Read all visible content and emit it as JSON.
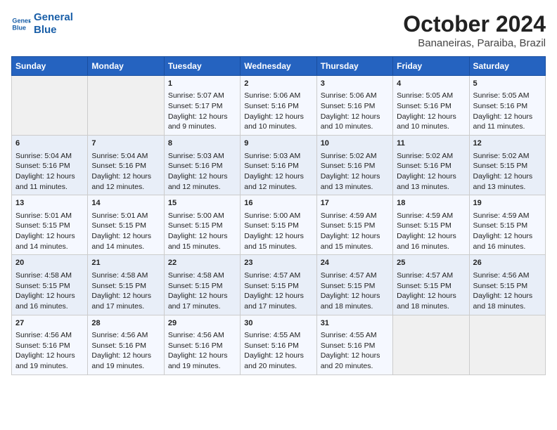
{
  "header": {
    "logo_line1": "General",
    "logo_line2": "Blue",
    "month": "October 2024",
    "location": "Bananeiras, Paraiba, Brazil"
  },
  "days_of_week": [
    "Sunday",
    "Monday",
    "Tuesday",
    "Wednesday",
    "Thursday",
    "Friday",
    "Saturday"
  ],
  "weeks": [
    [
      {
        "day": "",
        "info": ""
      },
      {
        "day": "",
        "info": ""
      },
      {
        "day": "1",
        "info": "Sunrise: 5:07 AM\nSunset: 5:17 PM\nDaylight: 12 hours\nand 9 minutes."
      },
      {
        "day": "2",
        "info": "Sunrise: 5:06 AM\nSunset: 5:16 PM\nDaylight: 12 hours\nand 10 minutes."
      },
      {
        "day": "3",
        "info": "Sunrise: 5:06 AM\nSunset: 5:16 PM\nDaylight: 12 hours\nand 10 minutes."
      },
      {
        "day": "4",
        "info": "Sunrise: 5:05 AM\nSunset: 5:16 PM\nDaylight: 12 hours\nand 10 minutes."
      },
      {
        "day": "5",
        "info": "Sunrise: 5:05 AM\nSunset: 5:16 PM\nDaylight: 12 hours\nand 11 minutes."
      }
    ],
    [
      {
        "day": "6",
        "info": "Sunrise: 5:04 AM\nSunset: 5:16 PM\nDaylight: 12 hours\nand 11 minutes."
      },
      {
        "day": "7",
        "info": "Sunrise: 5:04 AM\nSunset: 5:16 PM\nDaylight: 12 hours\nand 12 minutes."
      },
      {
        "day": "8",
        "info": "Sunrise: 5:03 AM\nSunset: 5:16 PM\nDaylight: 12 hours\nand 12 minutes."
      },
      {
        "day": "9",
        "info": "Sunrise: 5:03 AM\nSunset: 5:16 PM\nDaylight: 12 hours\nand 12 minutes."
      },
      {
        "day": "10",
        "info": "Sunrise: 5:02 AM\nSunset: 5:16 PM\nDaylight: 12 hours\nand 13 minutes."
      },
      {
        "day": "11",
        "info": "Sunrise: 5:02 AM\nSunset: 5:16 PM\nDaylight: 12 hours\nand 13 minutes."
      },
      {
        "day": "12",
        "info": "Sunrise: 5:02 AM\nSunset: 5:15 PM\nDaylight: 12 hours\nand 13 minutes."
      }
    ],
    [
      {
        "day": "13",
        "info": "Sunrise: 5:01 AM\nSunset: 5:15 PM\nDaylight: 12 hours\nand 14 minutes."
      },
      {
        "day": "14",
        "info": "Sunrise: 5:01 AM\nSunset: 5:15 PM\nDaylight: 12 hours\nand 14 minutes."
      },
      {
        "day": "15",
        "info": "Sunrise: 5:00 AM\nSunset: 5:15 PM\nDaylight: 12 hours\nand 15 minutes."
      },
      {
        "day": "16",
        "info": "Sunrise: 5:00 AM\nSunset: 5:15 PM\nDaylight: 12 hours\nand 15 minutes."
      },
      {
        "day": "17",
        "info": "Sunrise: 4:59 AM\nSunset: 5:15 PM\nDaylight: 12 hours\nand 15 minutes."
      },
      {
        "day": "18",
        "info": "Sunrise: 4:59 AM\nSunset: 5:15 PM\nDaylight: 12 hours\nand 16 minutes."
      },
      {
        "day": "19",
        "info": "Sunrise: 4:59 AM\nSunset: 5:15 PM\nDaylight: 12 hours\nand 16 minutes."
      }
    ],
    [
      {
        "day": "20",
        "info": "Sunrise: 4:58 AM\nSunset: 5:15 PM\nDaylight: 12 hours\nand 16 minutes."
      },
      {
        "day": "21",
        "info": "Sunrise: 4:58 AM\nSunset: 5:15 PM\nDaylight: 12 hours\nand 17 minutes."
      },
      {
        "day": "22",
        "info": "Sunrise: 4:58 AM\nSunset: 5:15 PM\nDaylight: 12 hours\nand 17 minutes."
      },
      {
        "day": "23",
        "info": "Sunrise: 4:57 AM\nSunset: 5:15 PM\nDaylight: 12 hours\nand 17 minutes."
      },
      {
        "day": "24",
        "info": "Sunrise: 4:57 AM\nSunset: 5:15 PM\nDaylight: 12 hours\nand 18 minutes."
      },
      {
        "day": "25",
        "info": "Sunrise: 4:57 AM\nSunset: 5:15 PM\nDaylight: 12 hours\nand 18 minutes."
      },
      {
        "day": "26",
        "info": "Sunrise: 4:56 AM\nSunset: 5:15 PM\nDaylight: 12 hours\nand 18 minutes."
      }
    ],
    [
      {
        "day": "27",
        "info": "Sunrise: 4:56 AM\nSunset: 5:16 PM\nDaylight: 12 hours\nand 19 minutes."
      },
      {
        "day": "28",
        "info": "Sunrise: 4:56 AM\nSunset: 5:16 PM\nDaylight: 12 hours\nand 19 minutes."
      },
      {
        "day": "29",
        "info": "Sunrise: 4:56 AM\nSunset: 5:16 PM\nDaylight: 12 hours\nand 19 minutes."
      },
      {
        "day": "30",
        "info": "Sunrise: 4:55 AM\nSunset: 5:16 PM\nDaylight: 12 hours\nand 20 minutes."
      },
      {
        "day": "31",
        "info": "Sunrise: 4:55 AM\nSunset: 5:16 PM\nDaylight: 12 hours\nand 20 minutes."
      },
      {
        "day": "",
        "info": ""
      },
      {
        "day": "",
        "info": ""
      }
    ]
  ]
}
